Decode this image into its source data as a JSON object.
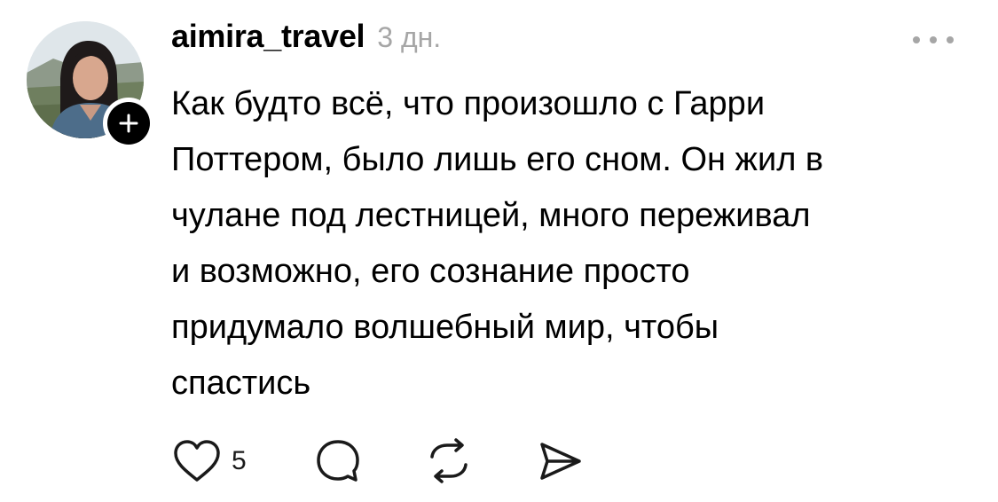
{
  "post": {
    "author": {
      "username": "aimira_travel",
      "time": "3 дн."
    },
    "body_lines": [
      "Как будто всё, что произошло с Гарри",
      "Поттером, было лишь его сном. Он жил в",
      "чулане под лестницей, много переживал",
      "и возможно, его сознание просто",
      "придумало волшебный мир, чтобы",
      "спастись"
    ],
    "actions": {
      "like_count": "5",
      "icons": [
        "heart-icon",
        "comment-icon",
        "repost-icon",
        "share-icon"
      ]
    }
  },
  "colors": {
    "text": "#000000",
    "muted": "#a6a6a6",
    "icon": "#1a1a1a"
  }
}
